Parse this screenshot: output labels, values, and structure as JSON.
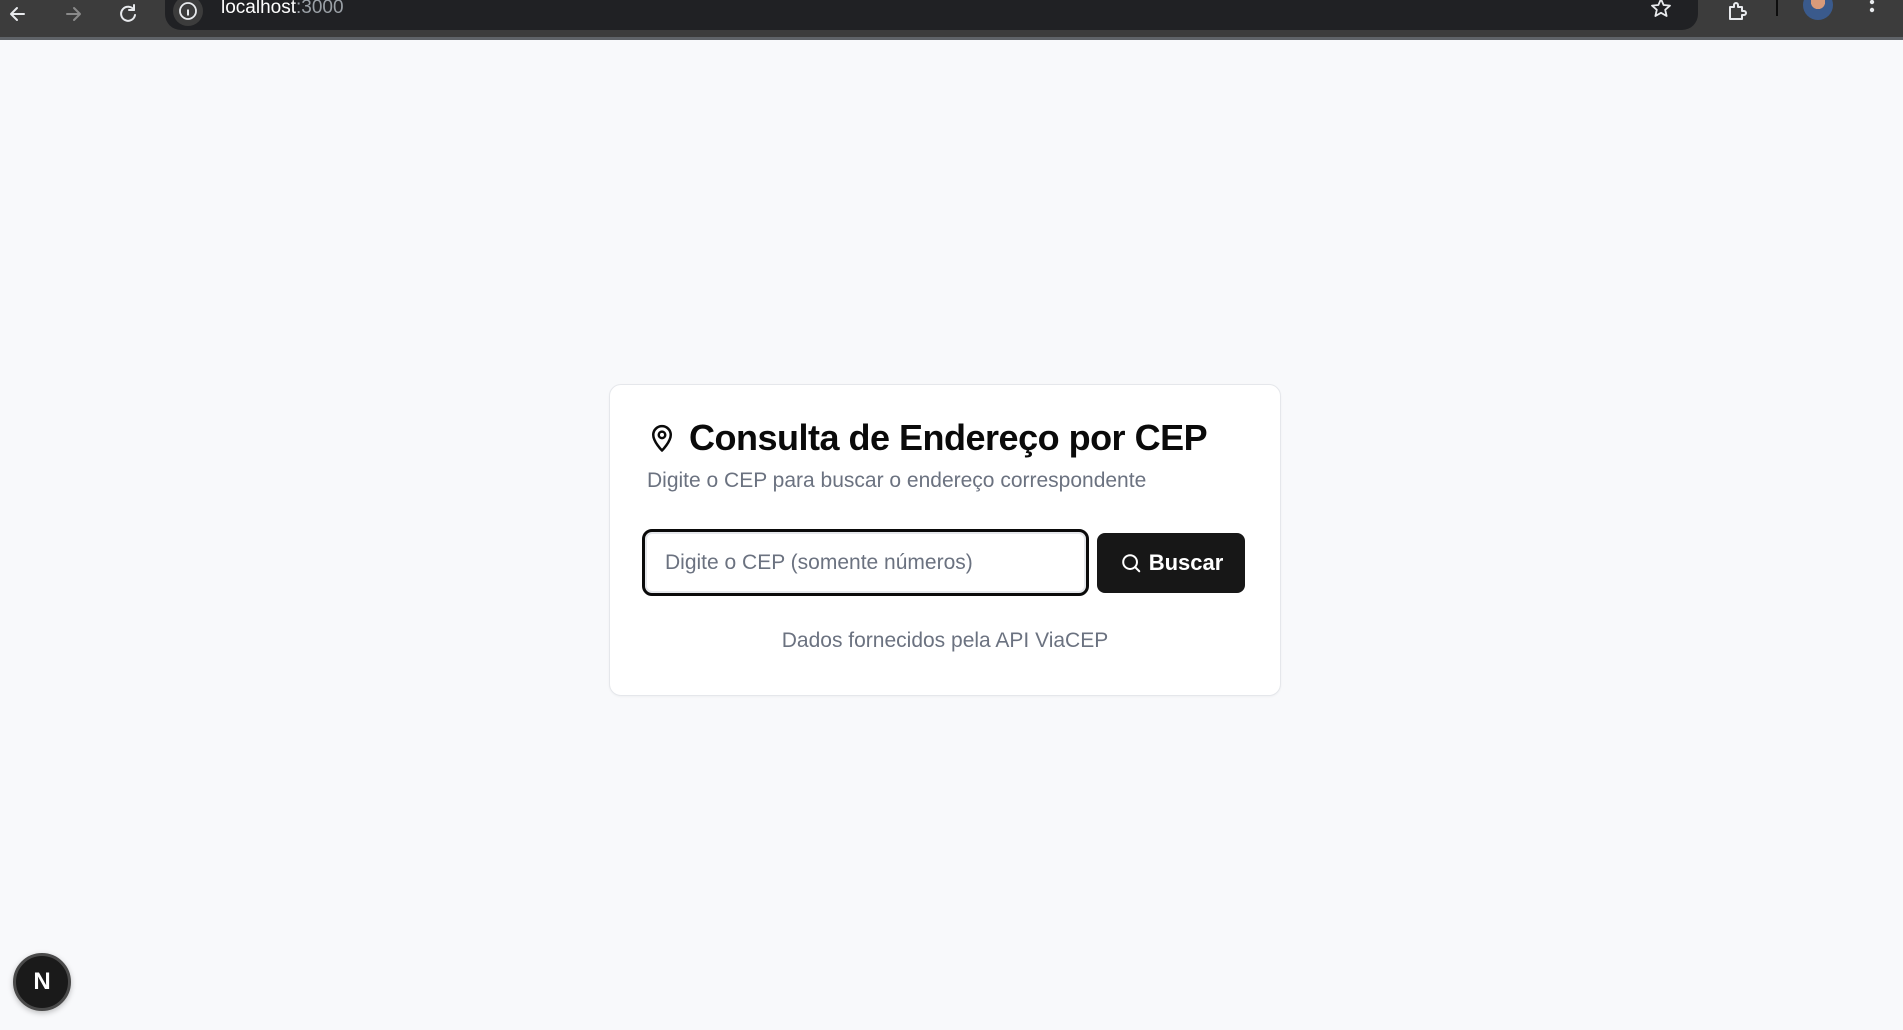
{
  "browser": {
    "url_host": "localhost",
    "url_port": ":3000",
    "icons": {
      "back": "arrow-left-icon",
      "forward": "arrow-right-icon",
      "reload": "reload-icon",
      "site_info": "info-icon",
      "bookmark": "star-icon",
      "extensions": "puzzle-icon",
      "menu": "kebab-menu-icon"
    }
  },
  "card": {
    "title": "Consulta de Endereço por CEP",
    "subtitle": "Digite o CEP para buscar o endereço correspondente",
    "input": {
      "placeholder": "Digite o CEP (somente números)",
      "value": ""
    },
    "button_label": "Buscar",
    "footer": "Dados fornecidos pela API ViaCEP",
    "icons": {
      "title": "map-pin-icon",
      "button": "search-icon"
    }
  },
  "dev_indicator": {
    "label": "N"
  },
  "colors": {
    "page_bg": "#f8f9fb",
    "card_bg": "#ffffff",
    "button_bg": "#171717",
    "muted_text": "#6b7280",
    "browser_bar": "#3c3c3c",
    "omnibox": "#202124"
  }
}
